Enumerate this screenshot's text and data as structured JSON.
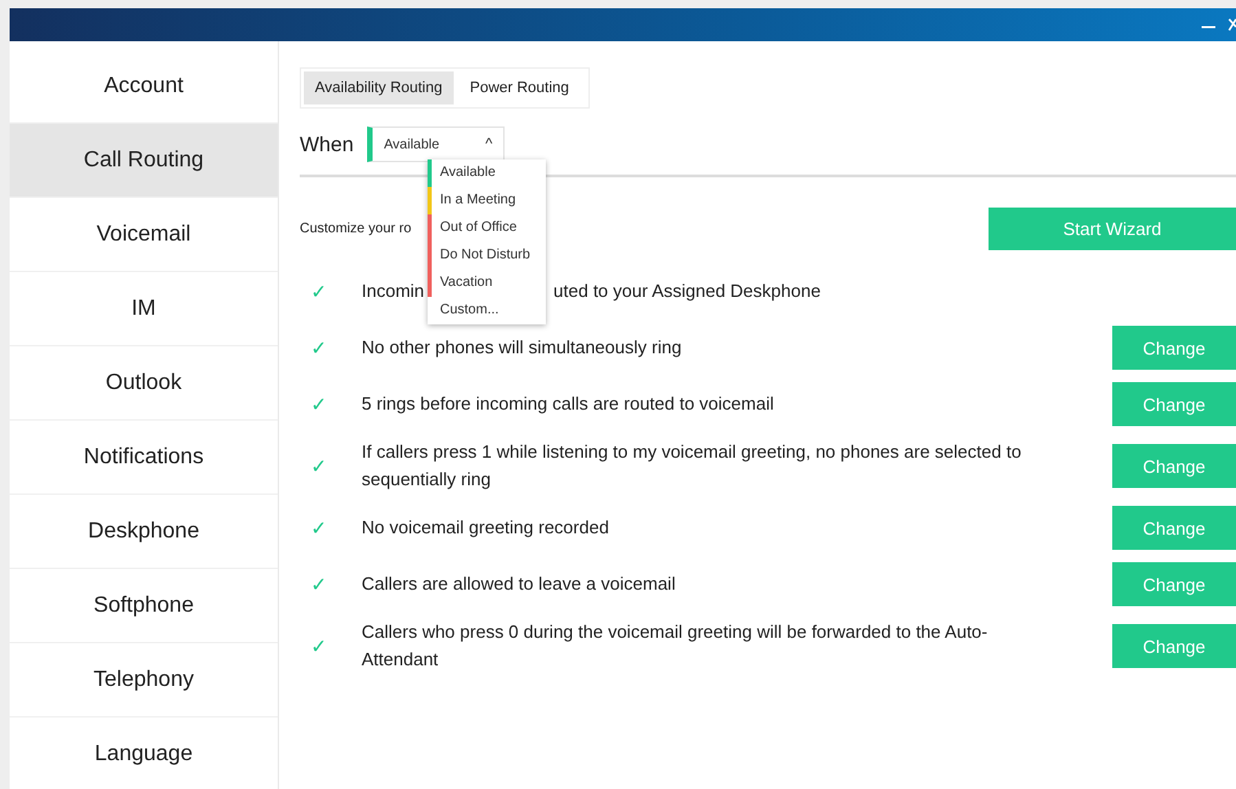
{
  "sidebar": {
    "items": [
      {
        "label": "Account",
        "selected": false
      },
      {
        "label": "Call Routing",
        "selected": true
      },
      {
        "label": "Voicemail",
        "selected": false
      },
      {
        "label": "IM",
        "selected": false
      },
      {
        "label": "Outlook",
        "selected": false
      },
      {
        "label": "Notifications",
        "selected": false
      },
      {
        "label": "Deskphone",
        "selected": false
      },
      {
        "label": "Softphone",
        "selected": false
      },
      {
        "label": "Telephony",
        "selected": false
      },
      {
        "label": "Language",
        "selected": false
      }
    ]
  },
  "tabs": [
    {
      "label": "Availability Routing",
      "selected": true
    },
    {
      "label": "Power Routing",
      "selected": false
    }
  ],
  "when": {
    "label": "When",
    "select": {
      "value": "Available",
      "color": "#21c98b",
      "caret": "^"
    }
  },
  "dropdown": {
    "options": [
      {
        "label": "Available",
        "color": "#21c98b"
      },
      {
        "label": "In a Meeting",
        "color": "#f2c618"
      },
      {
        "label": "Out of Office",
        "color": "#f0605d"
      },
      {
        "label": "Do Not Disturb",
        "color": "#f0605d"
      },
      {
        "label": "Vacation",
        "color": "#f0605d"
      },
      {
        "label": "Custom..."
      }
    ]
  },
  "description": "Customize your ro",
  "start_wizard": "Start Wizard",
  "rules": [
    {
      "check": "✓",
      "fragments": [
        "Incomin",
        "uted to your Assigned Deskphone"
      ]
    },
    {
      "check": "✓",
      "text": "No other phones will simultaneously ring",
      "button": "Change"
    },
    {
      "check": "✓",
      "text": "5 rings before incoming calls are routed to voicemail",
      "button": "Change"
    },
    {
      "check": "✓",
      "text": "If callers press 1 while listening to my voicemail greeting, no phones are selected to sequentially ring",
      "button": "Change"
    },
    {
      "check": "✓",
      "text": "No voicemail greeting recorded",
      "button": "Change"
    },
    {
      "check": "✓",
      "text": "Callers are allowed to leave a voicemail",
      "button": "Change"
    },
    {
      "check": "✓",
      "text": "Callers who press 0 during the voicemail greeting will be forwarded to the Auto-Attendant",
      "button": "Change"
    }
  ]
}
